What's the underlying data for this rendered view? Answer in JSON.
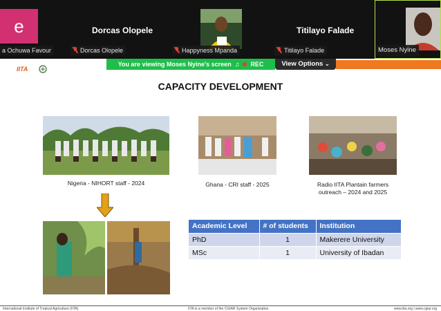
{
  "participants": [
    {
      "display_label": "e",
      "chip": "a Ochuwa Favour"
    },
    {
      "name": "Dorcas Olopele",
      "chip": "Dorcas Olopele"
    },
    {
      "chip": "Happyness Mpanda"
    },
    {
      "name": "Titilayo Falade",
      "chip": "Titilayo Falade"
    },
    {
      "chip": "Moses Nyine"
    }
  ],
  "banner": {
    "viewing_text": "You are viewing  Moses Nyine's screen",
    "rec_label": "REC",
    "view_options_label": "View Options"
  },
  "slide": {
    "logo_text": "IITA",
    "title": "CAPACITY DEVELOPMENT",
    "captions": {
      "nigeria": "Nigeria - NIHORT staff - 2024",
      "ghana": "Ghana - CRI staff - 2025",
      "radio_line1": "Radio IITA Plantain farmers",
      "radio_line2": "outreach – 2024 and 2025"
    },
    "table": {
      "headers": [
        "Academic Level",
        "# of students",
        "Institution"
      ],
      "rows": [
        [
          "PhD",
          "1",
          "Makerere University"
        ],
        [
          "MSc",
          "1",
          "University of Ibadan"
        ]
      ]
    }
  },
  "footer": {
    "left": "International Institute of Tropical Agriculture (IITA)",
    "center": "IITA is a member of the CGIAR System Organization.",
    "right": "www.iita.org  |  www.cgiar.org"
  },
  "colors": {
    "banner_green": "#1fbe4b",
    "header_blue": "#4472c4",
    "accent_orange": "#f07820",
    "avatar_pink": "#d23070"
  }
}
